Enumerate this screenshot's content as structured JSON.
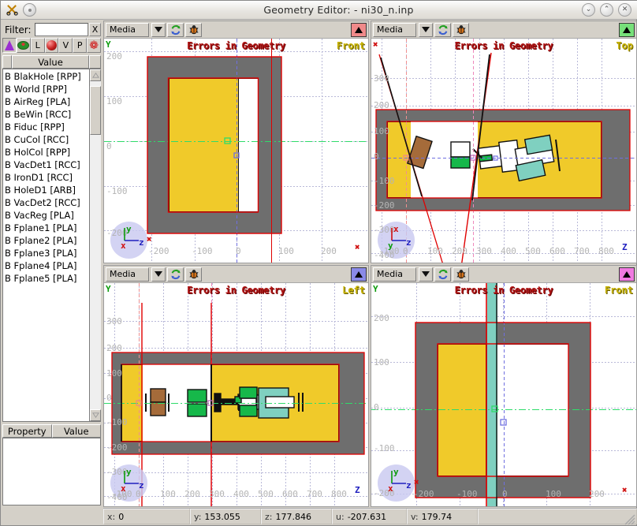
{
  "window": {
    "title": "Geometry Editor:  - ni30_n.inp",
    "app_icon": "scissors-icon",
    "menu_icon": "circle-dot-icon",
    "buttons": [
      {
        "name": "minimize-button",
        "glyph": "⌄"
      },
      {
        "name": "maximize-button",
        "glyph": "⌃"
      },
      {
        "name": "close-button",
        "glyph": "✕"
      }
    ]
  },
  "sidebar": {
    "filter": {
      "label": "Filter:",
      "value": "",
      "placeholder": "",
      "clear_label": "X"
    },
    "tool_icons": [
      {
        "name": "cone-icon",
        "label": ""
      },
      {
        "name": "torus-icon",
        "label": ""
      },
      {
        "name": "lattice-icon",
        "label": "L"
      },
      {
        "name": "sphere-icon",
        "label": ""
      },
      {
        "name": "voxel-icon",
        "label": "V"
      },
      {
        "name": "point-icon",
        "label": "P"
      },
      {
        "name": "flame-icon",
        "label": "❁"
      }
    ],
    "list_header": {
      "left": "",
      "value": "Value",
      "right": ""
    },
    "items": [
      "B BlakHole  [RPP]",
      "B World  [RPP]",
      "B AirReg  [PLA]",
      "B BeWin  [RCC]",
      "B Fiduc  [RPP]",
      "B CuCol  [RCC]",
      "B HolCol  [RPP]",
      "B VacDet1  [RCC]",
      "B IronD1  [RCC]",
      "B HoleD1  [ARB]",
      "B VacDet2  [RCC]",
      "B VacReg  [PLA]",
      "B Fplane1  [PLA]",
      "B Fplane2  [PLA]",
      "B Fplane3  [PLA]",
      "B Fplane4  [PLA]",
      "B Fplane5  [PLA]"
    ],
    "property_header": {
      "property": "Property",
      "value": "Value"
    },
    "property_rows": []
  },
  "viewports": [
    {
      "id": "top-left",
      "toolbar": {
        "combo_value": "Media",
        "refresh_icon": "refresh-icon",
        "bug_icon": "bug-icon",
        "flag_color": "#f08a8a",
        "flag_name": "viewport-color-flag"
      },
      "title": "Errors in Geometry",
      "view_label": "Front",
      "y_ticks": [
        "200",
        "100",
        "0",
        "-100",
        "-200"
      ],
      "x_ticks": [
        "-200",
        "-100",
        "0",
        "100",
        "200"
      ],
      "compass": {
        "up": "y",
        "right": "z",
        "origin": "x"
      }
    },
    {
      "id": "top-right",
      "toolbar": {
        "combo_value": "Media",
        "refresh_icon": "refresh-icon",
        "bug_icon": "bug-icon",
        "flag_color": "#77e07a",
        "flag_name": "viewport-color-flag"
      },
      "title": "Errors in Geometry",
      "view_label": "Top",
      "y_ticks": [
        "300",
        "200",
        "100",
        "0",
        "-100",
        "-200",
        "-300",
        "-400"
      ],
      "x_ticks": [
        "-100",
        "0",
        "100",
        "200",
        "300",
        "400",
        "500",
        "600",
        "700",
        "800"
      ],
      "compass": {
        "up": "x",
        "right": "z",
        "origin": "y"
      }
    },
    {
      "id": "bottom-left",
      "toolbar": {
        "combo_value": "Media",
        "refresh_icon": "refresh-icon",
        "bug_icon": "bug-icon",
        "flag_color": "#8a8ae8",
        "flag_name": "viewport-color-flag"
      },
      "title": "Errors in Geometry",
      "view_label": "Left",
      "y_ticks": [
        "300",
        "200",
        "100",
        "0",
        "-100",
        "-200",
        "-300",
        "-400"
      ],
      "x_ticks": [
        "-100",
        "0",
        "100",
        "200",
        "300",
        "400",
        "500",
        "600",
        "700",
        "800"
      ],
      "compass": {
        "up": "y",
        "right": "z",
        "origin": "x"
      }
    },
    {
      "id": "bottom-right",
      "toolbar": {
        "combo_value": "Media",
        "refresh_icon": "refresh-icon",
        "bug_icon": "bug-icon",
        "flag_color": "#f07ae0",
        "flag_name": "viewport-color-flag"
      },
      "title": "Errors in Geometry",
      "view_label": "Front",
      "y_ticks": [
        "200",
        "100",
        "0",
        "-100",
        "-200"
      ],
      "x_ticks": [
        "-200",
        "-100",
        "0",
        "100",
        "200"
      ],
      "compass": {
        "up": "y",
        "right": "z",
        "origin": "x"
      }
    }
  ],
  "statusbar": {
    "x": {
      "key": "x:",
      "value": "0"
    },
    "y": {
      "key": "y:",
      "value": "153.055"
    },
    "z": {
      "key": "z:",
      "value": "177.846"
    },
    "u": {
      "key": "u:",
      "value": "-207.631"
    },
    "v": {
      "key": "v:",
      "value": "179.74"
    }
  },
  "colors": {
    "region_gray": "#6e6e6e",
    "region_yellow": "#f0ca2a",
    "accent_red": "#e00000",
    "teal": "#7fd0c0",
    "green": "#16b84a",
    "brown": "#a56b3a"
  }
}
